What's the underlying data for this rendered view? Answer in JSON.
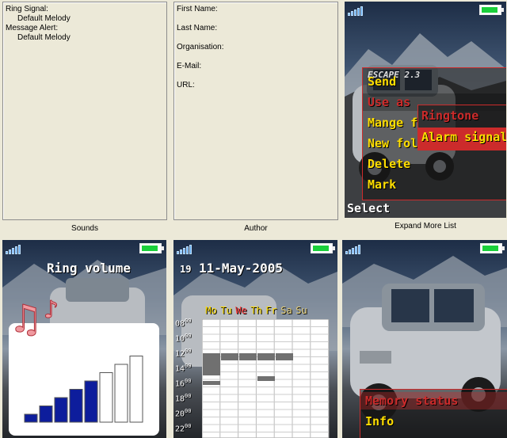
{
  "panels": {
    "sounds": {
      "caption": "Sounds",
      "lines": [
        {
          "label": "Ring Signal:",
          "value": "Default Melody"
        },
        {
          "label": "Message Alert:",
          "value": "Default Melody"
        }
      ]
    },
    "author": {
      "caption": "Author",
      "fields": [
        "First Name:",
        "Last Name:",
        "Organisation:",
        "E-Mail:",
        "URL:"
      ]
    }
  },
  "expand_more_list": {
    "caption": "Expand More List",
    "menu_items": [
      "Send",
      "Use as",
      "Mange f",
      "New fol",
      "Delete",
      "Mark"
    ],
    "submenu_items": [
      "Ringtone",
      "Alarm signal"
    ],
    "softkey": "Select",
    "logo_text": "ESCAPE 2.3"
  },
  "ring_volume": {
    "title": "Ring volume",
    "note_icon": "music-notes-icon",
    "level": 5,
    "total_bars": 8
  },
  "calendar": {
    "day": "19",
    "date": "11-May-2005",
    "weekdays": [
      "Mo",
      "Tu",
      "We",
      "Th",
      "Fr",
      "Sa",
      "Su"
    ],
    "active_weekday": "We",
    "times": [
      "08",
      "10",
      "12",
      "14",
      "16",
      "18",
      "20",
      "22"
    ],
    "time_suffix": "00"
  },
  "memory_screen": {
    "menu_items": [
      "Memory status",
      "Info"
    ]
  },
  "colors": {
    "menu_text": "#ffde00",
    "highlight": "#cc2b2b",
    "volume_fill": "#0d1d9c",
    "weekend_text": "#ff3b3b",
    "battery": "#1bd03b"
  }
}
